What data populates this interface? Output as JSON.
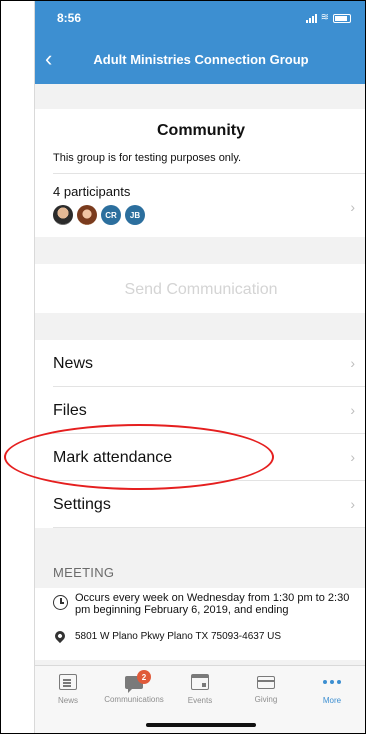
{
  "status": {
    "time": "8:56"
  },
  "header": {
    "title": "Adult Ministries Connection Group",
    "back_icon": "chevron-left-icon"
  },
  "group": {
    "name": "Community",
    "description": "This group is for testing purposes only.",
    "participants_label": "4 participants",
    "avatars": [
      "",
      "",
      "CR",
      "JB"
    ]
  },
  "send_label": "Send Communication",
  "menu": [
    {
      "label": "News"
    },
    {
      "label": "Files"
    },
    {
      "label": "Mark attendance"
    },
    {
      "label": "Settings"
    }
  ],
  "meeting": {
    "header": "MEETING",
    "schedule": "Occurs every week on Wednesday from 1:30 pm to 2:30 pm beginning February 6, 2019, and ending",
    "address": "5801 W Plano Pkwy Plano TX 75093-4637 US"
  },
  "tabs": [
    {
      "label": "News",
      "icon": "news-icon"
    },
    {
      "label": "Communications",
      "icon": "communications-icon",
      "badge": "2"
    },
    {
      "label": "Events",
      "icon": "calendar-icon"
    },
    {
      "label": "Giving",
      "icon": "card-icon"
    },
    {
      "label": "More",
      "icon": "more-icon",
      "active": true
    }
  ],
  "colors": {
    "accent": "#3d8fd1",
    "annotation": "#e51f1f",
    "badge": "#e05a3a"
  }
}
